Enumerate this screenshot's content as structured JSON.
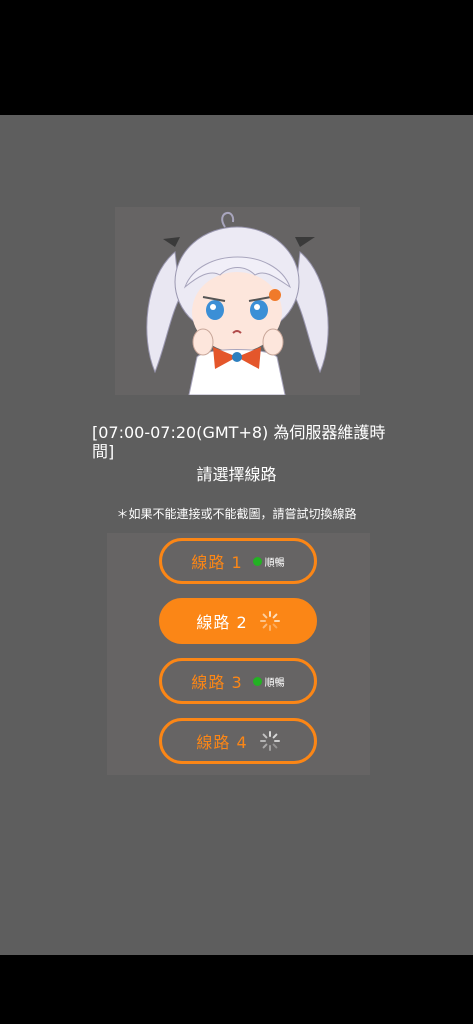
{
  "notice": "[07:00-07:20(GMT+8) 為伺服器維護時間]",
  "select_title": "請選擇線路",
  "hint": "＊如果不能連接或不能截圖，請嘗試切換線路",
  "lines": [
    {
      "label": "線路 1",
      "status": "順暢",
      "state": "ok",
      "active": false
    },
    {
      "label": "線路 2",
      "status": "",
      "state": "loading",
      "active": true
    },
    {
      "label": "線路 3",
      "status": "順暢",
      "state": "ok",
      "active": false
    },
    {
      "label": "線路 4",
      "status": "",
      "state": "loading",
      "active": false
    }
  ],
  "colors": {
    "accent": "#fb8616",
    "ok": "#23b223",
    "background": "#5e5e5e"
  }
}
